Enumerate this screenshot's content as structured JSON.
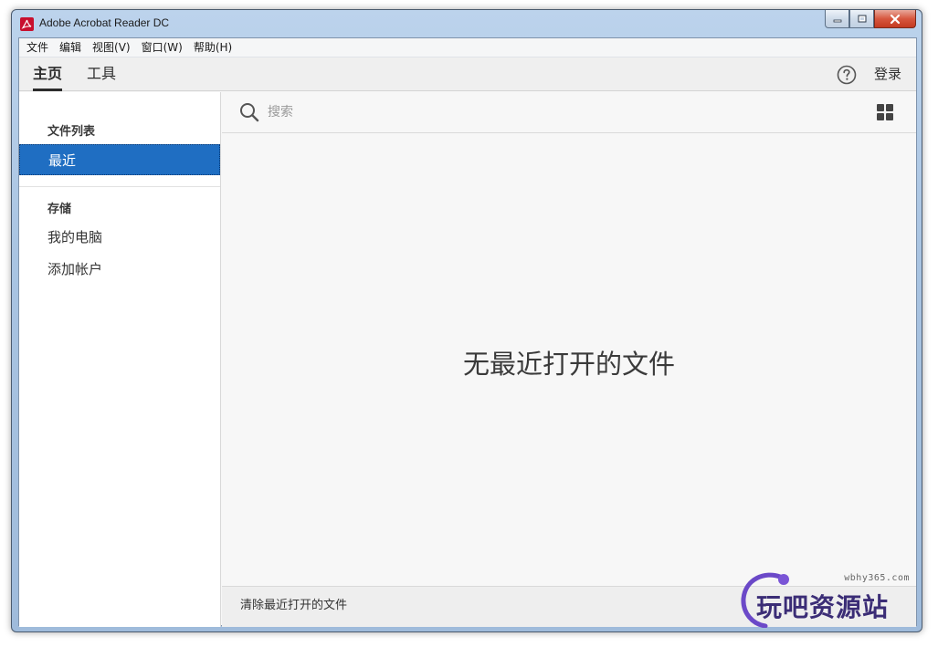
{
  "window": {
    "title": "Adobe Acrobat Reader DC"
  },
  "menu": {
    "items": [
      {
        "label": "文件"
      },
      {
        "label": "编辑"
      },
      {
        "label": "视图(V)"
      },
      {
        "label": "窗口(W)"
      },
      {
        "label": "帮助(H)"
      }
    ]
  },
  "nav": {
    "home_tab": "主页",
    "tools_tab": "工具",
    "help_icon": "question-circle",
    "login": "登录"
  },
  "sidebar": {
    "files_heading": "文件列表",
    "recent": "最近",
    "storage_heading": "存储",
    "my_computer": "我的电脑",
    "add_account": "添加帐户"
  },
  "search": {
    "placeholder": "搜索",
    "value": ""
  },
  "main": {
    "empty_message": "无最近打开的文件",
    "clear_recent": "清除最近打开的文件"
  },
  "watermark": {
    "url": "wbhy365.com",
    "text": "玩吧资源站"
  },
  "colors": {
    "accent": "#1f6ec2",
    "brand_red": "#c8102e"
  }
}
